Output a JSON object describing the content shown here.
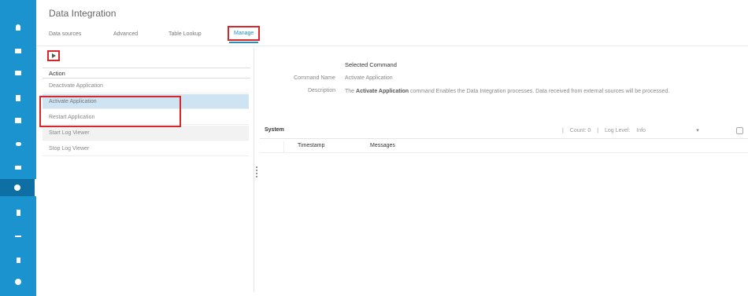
{
  "app": {
    "title": "Data Integration"
  },
  "tabs": [
    {
      "label": "Data sources"
    },
    {
      "label": "Advanced"
    },
    {
      "label": "Table Lookup"
    },
    {
      "label": "Manage"
    }
  ],
  "rail_icons": [
    "bulb-icon",
    "monitor-icon",
    "display-icon",
    "document-icon",
    "calendar-icon",
    "broadcast-icon",
    "camera-icon",
    "gear-icon",
    "device-icon",
    "arrows-icon",
    "flag-icon",
    "info-icon"
  ],
  "actions": {
    "header": "Action",
    "items": [
      {
        "label": "Deactivate Application"
      },
      {
        "label": "Activate Application"
      },
      {
        "label": "Restart Application"
      },
      {
        "label": "Start Log Viewer"
      },
      {
        "label": "Stop Log Viewer"
      }
    ]
  },
  "selected_command": {
    "title": "Selected Command",
    "name_label": "Command Name",
    "name_value": "Activate Application",
    "desc_label": "Description",
    "desc_prefix": "The",
    "desc_bold": "Activate Application",
    "desc_suffix": "command Enables the Data Integration processes. Data received from external sources will be processed."
  },
  "system": {
    "title": "System",
    "count_label": "Count: 0",
    "log_level_label": "Log Level:",
    "log_level_value": "Info"
  },
  "log_table": {
    "columns": [
      "Timestamp",
      "Messages"
    ]
  },
  "colors": {
    "rail": "#1b93cf",
    "accent": "#1b93cf",
    "highlight": "#d9262b",
    "selected_row": "#cfe4f2"
  }
}
